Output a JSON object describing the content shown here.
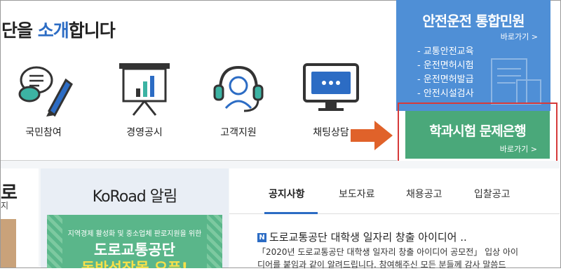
{
  "intro": {
    "prefix": "단을 ",
    "highlight": "소개",
    "suffix": "합니다"
  },
  "services": [
    {
      "label": "국민참여"
    },
    {
      "label": "경영공시"
    },
    {
      "label": "고객지원"
    },
    {
      "label": "채팅상담"
    }
  ],
  "civil_service": {
    "title": "안전운전 통합민원",
    "go": "바로가기 >",
    "items": [
      "- 교통안전교육",
      "- 운전면허시험",
      "- 운전면허발급",
      "- 안전시설검사"
    ]
  },
  "exam_bank": {
    "title": "학과시험 문제은행",
    "go": "바로가기 >"
  },
  "left_panel": {
    "title": "로",
    "sub": "지"
  },
  "koroad_news": {
    "title": "KoRoad 알림",
    "banner": {
      "line1": "지역경제 활성화 및 중소업체 판로지원을 위한",
      "line2": "도로교통공단",
      "line3": "동반성장몰 오픈!"
    }
  },
  "notice": {
    "tabs": [
      "공지사항",
      "보도자료",
      "채용공고",
      "입찰공고"
    ],
    "badge": "N",
    "headline": "도로교통공단 대학생 일자리 창출 아이디어 ..",
    "body_line1": "「2020년 도로교통공단 대학생 일자리 창출 아이디어 공모전」 입상 아이",
    "body_line2": "디어를 붙임과 같이 알려드립니다. 참여해주신 모든 분들께 감사 말씀드"
  },
  "colors": {
    "accent_blue": "#2c6cc4",
    "civil_bg": "#4f8fd6",
    "exam_bg": "#4aa87a",
    "highlight_box": "#d63a3a",
    "arrow": "#e0622a"
  }
}
